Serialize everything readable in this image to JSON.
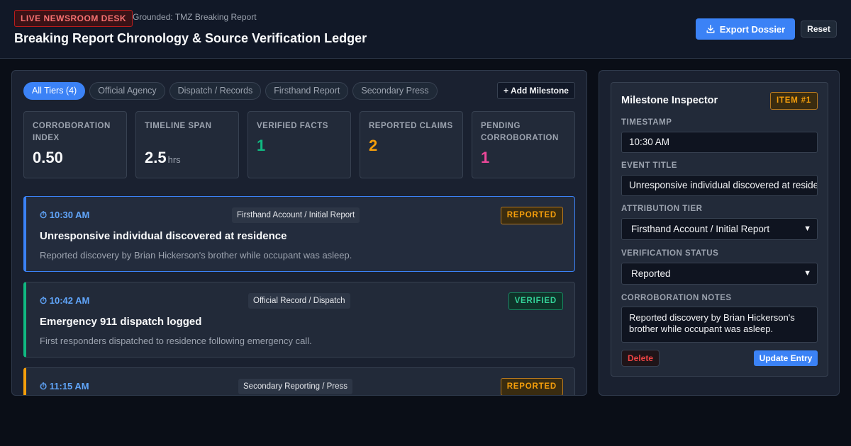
{
  "header": {
    "badge": "LIVE NEWSROOM DESK",
    "grounded": "Grounded: TMZ Breaking Report",
    "title": "Breaking Report Chronology & Source Verification Ledger",
    "export_label": "Export Dossier",
    "reset_label": "Reset"
  },
  "tabs": [
    {
      "label": "All Tiers (4)",
      "active": true
    },
    {
      "label": "Official Agency",
      "active": false
    },
    {
      "label": "Dispatch / Records",
      "active": false
    },
    {
      "label": "Firsthand Report",
      "active": false
    },
    {
      "label": "Secondary Press",
      "active": false
    }
  ],
  "add_milestone_label": "+ Add Milestone",
  "stats": [
    {
      "label": "CORROBORATION INDEX",
      "value": "0.50",
      "unit": "",
      "color": "#f9fafb"
    },
    {
      "label": "TIMELINE SPAN",
      "value": "2.5",
      "unit": "hrs",
      "color": "#f9fafb"
    },
    {
      "label": "VERIFIED FACTS",
      "value": "1",
      "unit": "",
      "color": "#10b981"
    },
    {
      "label": "REPORTED CLAIMS",
      "value": "2",
      "unit": "",
      "color": "#f59e0b"
    },
    {
      "label": "PENDING CORROBORATION",
      "value": "1",
      "unit": "",
      "color": "#ec4899"
    }
  ],
  "entries": [
    {
      "time": "⏱ 10:30 AM",
      "tier": "Firsthand Account / Initial Report",
      "status": "REPORTED",
      "title": "Unresponsive individual discovered at residence",
      "desc": "Reported discovery by Brian Hickerson's brother while occupant was asleep."
    },
    {
      "time": "⏱ 10:42 AM",
      "tier": "Official Record / Dispatch",
      "status": "VERIFIED",
      "title": "Emergency 911 dispatch logged",
      "desc": "First responders dispatched to residence following emergency call."
    },
    {
      "time": "⏱ 11:15 AM",
      "tier": "Secondary Reporting / Press",
      "status": "REPORTED",
      "title": "",
      "desc": ""
    }
  ],
  "inspector": {
    "title": "Milestone Inspector",
    "item_badge": "ITEM #1",
    "timestamp_label": "TIMESTAMP",
    "timestamp_value": "10:30 AM",
    "event_title_label": "EVENT TITLE",
    "event_title_value": "Unresponsive individual discovered at residence",
    "tier_label": "ATTRIBUTION TIER",
    "tier_value": "Firsthand Account / Initial Report",
    "status_label": "VERIFICATION STATUS",
    "status_value": "Reported",
    "notes_label": "CORROBORATION NOTES",
    "notes_value": "Reported discovery by Brian Hickerson's brother while occupant was asleep.",
    "delete_label": "Delete",
    "update_label": "Update Entry"
  },
  "colors": {
    "accent": "#3b82f6",
    "verified": "#10b981",
    "reported": "#f59e0b",
    "pending": "#ec4899"
  }
}
